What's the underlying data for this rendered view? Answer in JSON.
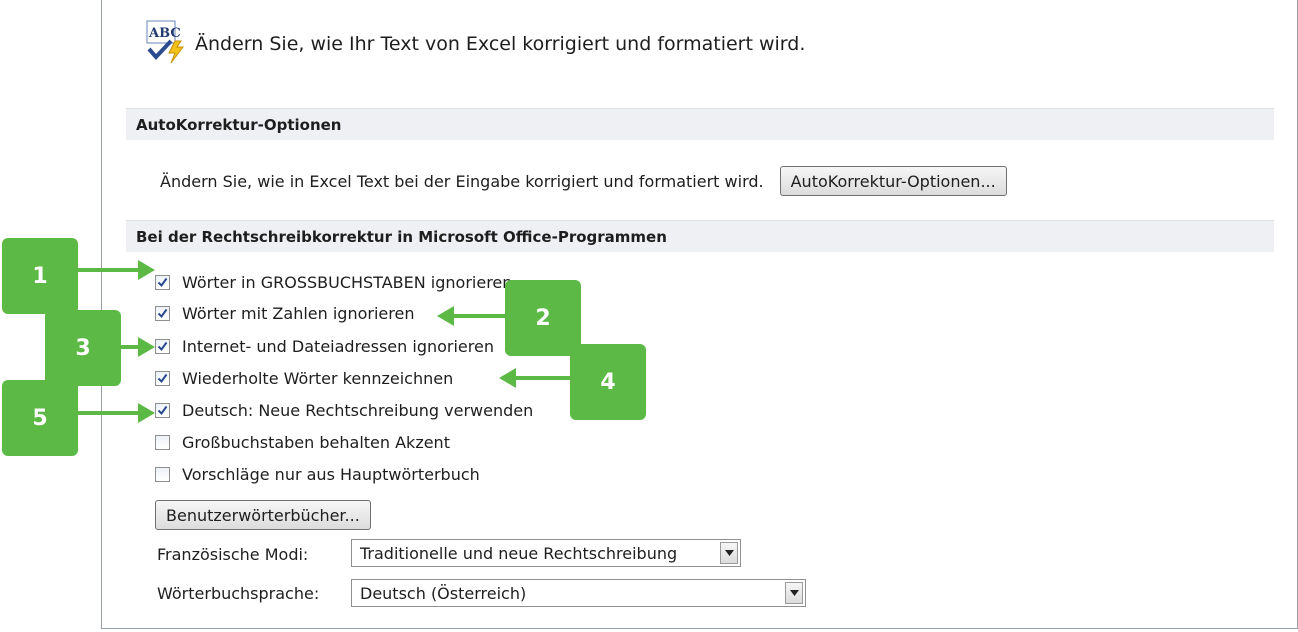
{
  "header": {
    "title": "Ändern Sie, wie Ihr Text von Excel korrigiert und formatiert wird.",
    "icon": "abc-spellcheck-icon"
  },
  "autocorrect_section": {
    "heading": "AutoKorrektur-Optionen",
    "description": "Ändern Sie, wie in Excel Text bei der Eingabe korrigiert und formatiert wird.",
    "button_label": "AutoKorrektur-Optionen..."
  },
  "spelling_section": {
    "heading": "Bei der Rechtschreibkorrektur in Microsoft Office-Programmen",
    "options": [
      {
        "label": "Wörter in GROSSBUCHSTABEN ignorieren",
        "checked": true
      },
      {
        "label": "Wörter mit Zahlen ignorieren",
        "checked": true
      },
      {
        "label": "Internet- und Dateiadressen ignorieren",
        "checked": true
      },
      {
        "label": "Wiederholte Wörter kennzeichnen",
        "checked": true
      },
      {
        "label": "Deutsch: Neue Rechtschreibung verwenden",
        "checked": true
      },
      {
        "label": "Großbuchstaben behalten Akzent",
        "checked": false
      },
      {
        "label": "Vorschläge nur aus Hauptwörterbuch",
        "checked": false
      }
    ],
    "dictionaries_button": "Benutzerwörterbücher...",
    "french_modes_label": "Französische Modi:",
    "french_modes_value": "Traditionelle und neue Rechtschreibung",
    "dictionary_language_label": "Wörterbuchsprache:",
    "dictionary_language_value": "Deutsch (Österreich)"
  },
  "callouts": [
    "1",
    "2",
    "3",
    "4",
    "5"
  ],
  "colors": {
    "callout_green": "#5cb946",
    "section_background": "#eef0f3",
    "checkmark": "#2a4b8d"
  }
}
